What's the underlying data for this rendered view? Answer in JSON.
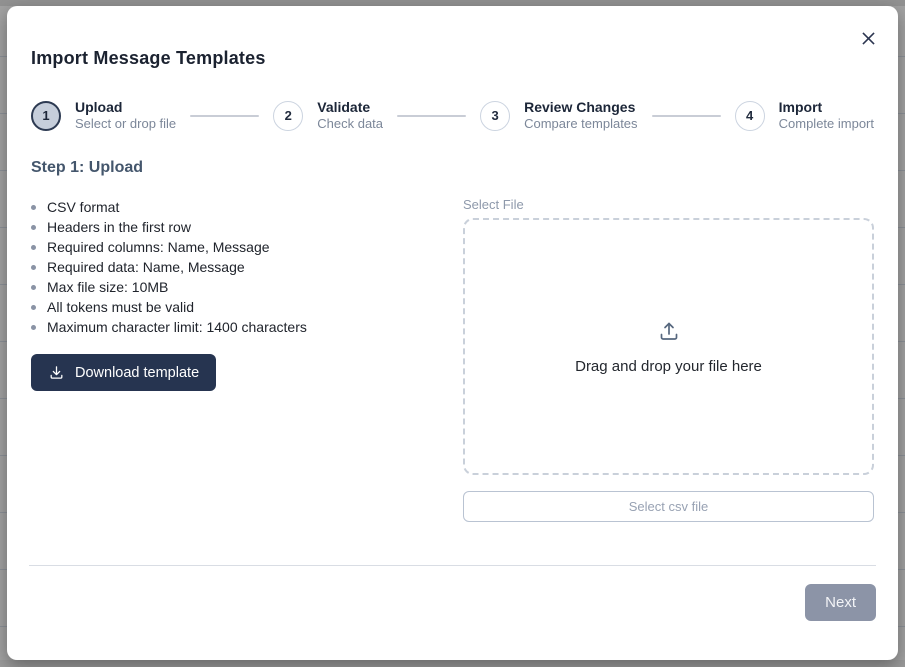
{
  "modal": {
    "title": "Import Message Templates"
  },
  "stepper": {
    "steps": [
      {
        "number": "1",
        "label": "Upload",
        "sublabel": "Select or drop file"
      },
      {
        "number": "2",
        "label": "Validate",
        "sublabel": "Check data"
      },
      {
        "number": "3",
        "label": "Review Changes",
        "sublabel": "Compare templates"
      },
      {
        "number": "4",
        "label": "Import",
        "sublabel": "Complete import"
      }
    ],
    "active_step": 1
  },
  "step_section": {
    "heading": "Step 1: Upload",
    "requirements": [
      "CSV format",
      "Headers in the first row",
      "Required columns: Name, Message",
      "Required data: Name, Message",
      "Max file size: 10MB",
      "All tokens must be valid",
      "Maximum character limit: 1400 characters"
    ],
    "download_button_label": "Download template"
  },
  "file_select": {
    "label": "Select File",
    "dropzone_text": "Drag and drop your file here",
    "select_button_label": "Select csv file"
  },
  "footer": {
    "next_button_label": "Next"
  },
  "icons": {
    "close": "close-icon",
    "download": "download-icon",
    "upload": "upload-icon"
  },
  "colors": {
    "primary_navy": "#263450",
    "active_step_fill": "#c6cedb",
    "active_step_border": "#2d3a52",
    "disabled_next": "#8c94a7",
    "backdrop_gray": "#a3a3a3"
  }
}
